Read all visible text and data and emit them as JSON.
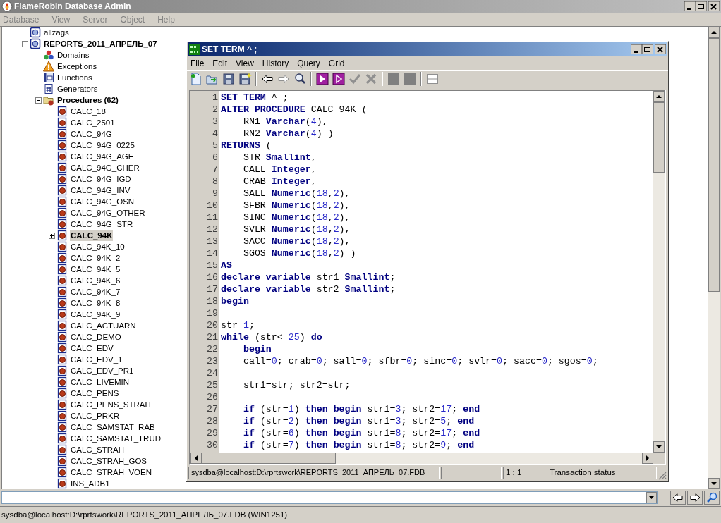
{
  "app": {
    "title": "FlameRobin Database Admin",
    "menu": [
      "Database",
      "View",
      "Server",
      "Object",
      "Help"
    ]
  },
  "tree": [
    {
      "kind": "database",
      "label": "allzags",
      "selected": false
    },
    {
      "kind": "database",
      "label": "REPORTS_2011_АПРЕЛЬ_07",
      "selected": false,
      "expanded": true,
      "children": [
        {
          "kind": "domains",
          "label": "Domains",
          "selected": false
        },
        {
          "kind": "exceptions",
          "label": "Exceptions",
          "selected": false
        },
        {
          "kind": "functions",
          "label": "Functions",
          "selected": false
        },
        {
          "kind": "generators",
          "label": "Generators",
          "selected": false
        },
        {
          "kind": "procedures",
          "label": "Procedures (62)",
          "selected": false,
          "expanded": true,
          "children": [
            {
              "kind": "procedure",
              "label": "CALC_18",
              "selected": false
            },
            {
              "kind": "procedure",
              "label": "CALC_2501",
              "selected": false
            },
            {
              "kind": "procedure",
              "label": "CALC_94G",
              "selected": false
            },
            {
              "kind": "procedure",
              "label": "CALC_94G_0225",
              "selected": false
            },
            {
              "kind": "procedure",
              "label": "CALC_94G_AGE",
              "selected": false
            },
            {
              "kind": "procedure",
              "label": "CALC_94G_CHER",
              "selected": false
            },
            {
              "kind": "procedure",
              "label": "CALC_94G_IGD",
              "selected": false
            },
            {
              "kind": "procedure",
              "label": "CALC_94G_INV",
              "selected": false
            },
            {
              "kind": "procedure",
              "label": "CALC_94G_OSN",
              "selected": false
            },
            {
              "kind": "procedure",
              "label": "CALC_94G_OTHER",
              "selected": false
            },
            {
              "kind": "procedure",
              "label": "CALC_94G_STR",
              "selected": false
            },
            {
              "kind": "procedure",
              "label": "CALC_94K",
              "selected": true,
              "expanded": false
            },
            {
              "kind": "procedure",
              "label": "CALC_94K_10",
              "selected": false
            },
            {
              "kind": "procedure",
              "label": "CALC_94K_2",
              "selected": false
            },
            {
              "kind": "procedure",
              "label": "CALC_94K_5",
              "selected": false
            },
            {
              "kind": "procedure",
              "label": "CALC_94K_6",
              "selected": false
            },
            {
              "kind": "procedure",
              "label": "CALC_94K_7",
              "selected": false
            },
            {
              "kind": "procedure",
              "label": "CALC_94K_8",
              "selected": false
            },
            {
              "kind": "procedure",
              "label": "CALC_94K_9",
              "selected": false
            },
            {
              "kind": "procedure",
              "label": "CALC_ACTUARN",
              "selected": false
            },
            {
              "kind": "procedure",
              "label": "CALC_DEMO",
              "selected": false
            },
            {
              "kind": "procedure",
              "label": "CALC_EDV",
              "selected": false
            },
            {
              "kind": "procedure",
              "label": "CALC_EDV_1",
              "selected": false
            },
            {
              "kind": "procedure",
              "label": "CALC_EDV_PR1",
              "selected": false
            },
            {
              "kind": "procedure",
              "label": "CALC_LIVEMIN",
              "selected": false
            },
            {
              "kind": "procedure",
              "label": "CALC_PENS",
              "selected": false
            },
            {
              "kind": "procedure",
              "label": "CALC_PENS_STRAH",
              "selected": false
            },
            {
              "kind": "procedure",
              "label": "CALC_PRKR",
              "selected": false
            },
            {
              "kind": "procedure",
              "label": "CALC_SAMSTAT_RAB",
              "selected": false
            },
            {
              "kind": "procedure",
              "label": "CALC_SAMSTAT_TRUD",
              "selected": false
            },
            {
              "kind": "procedure",
              "label": "CALC_STRAH",
              "selected": false
            },
            {
              "kind": "procedure",
              "label": "CALC_STRAH_GOS",
              "selected": false
            },
            {
              "kind": "procedure",
              "label": "CALC_STRAH_VOEN",
              "selected": false
            },
            {
              "kind": "procedure",
              "label": "INS_ADB1",
              "selected": false
            }
          ]
        }
      ]
    }
  ],
  "editor_window": {
    "title": "SET TERM ^ ;",
    "menu": [
      "File",
      "Edit",
      "View",
      "History",
      "Query",
      "Grid"
    ],
    "toolbar": [
      {
        "kind": "new",
        "disabled": false
      },
      {
        "kind": "open",
        "disabled": false
      },
      {
        "kind": "save",
        "disabled": false
      },
      {
        "kind": "save_as",
        "disabled": false
      },
      {
        "kind": "separator"
      },
      {
        "kind": "back",
        "disabled": false
      },
      {
        "kind": "forward",
        "disabled": true
      },
      {
        "kind": "find",
        "disabled": false
      },
      {
        "kind": "separator"
      },
      {
        "kind": "execute",
        "disabled": false
      },
      {
        "kind": "execute_step",
        "disabled": false
      },
      {
        "kind": "commit",
        "disabled": true
      },
      {
        "kind": "rollback",
        "disabled": true
      },
      {
        "kind": "separator"
      },
      {
        "kind": "grid_cell",
        "disabled": true
      },
      {
        "kind": "grid_cell",
        "disabled": true
      },
      {
        "kind": "separator"
      },
      {
        "kind": "split",
        "disabled": true
      }
    ],
    "lines": [
      {
        "number": "1",
        "tokens": [
          {
            "kind": "kw",
            "text": "SET TERM"
          },
          {
            "kind": "plain",
            "text": " ^ ;"
          }
        ]
      },
      {
        "number": "2",
        "tokens": [
          {
            "kind": "kw",
            "text": "ALTER PROCEDURE"
          },
          {
            "kind": "plain",
            "text": " CALC_94K ("
          }
        ]
      },
      {
        "number": "3",
        "tokens": [
          {
            "kind": "plain",
            "text": "    RN1 "
          },
          {
            "kind": "kw",
            "text": "Varchar"
          },
          {
            "kind": "plain",
            "text": "("
          },
          {
            "kind": "num",
            "text": "4"
          },
          {
            "kind": "plain",
            "text": "),"
          }
        ]
      },
      {
        "number": "4",
        "tokens": [
          {
            "kind": "plain",
            "text": "    RN2 "
          },
          {
            "kind": "kw",
            "text": "Varchar"
          },
          {
            "kind": "plain",
            "text": "("
          },
          {
            "kind": "num",
            "text": "4"
          },
          {
            "kind": "plain",
            "text": ") )"
          }
        ]
      },
      {
        "number": "5",
        "tokens": [
          {
            "kind": "kw",
            "text": "RETURNS"
          },
          {
            "kind": "plain",
            "text": " ("
          }
        ]
      },
      {
        "number": "6",
        "tokens": [
          {
            "kind": "plain",
            "text": "    STR "
          },
          {
            "kind": "kw",
            "text": "Smallint"
          },
          {
            "kind": "plain",
            "text": ","
          }
        ]
      },
      {
        "number": "7",
        "tokens": [
          {
            "kind": "plain",
            "text": "    CALL "
          },
          {
            "kind": "kw",
            "text": "Integer"
          },
          {
            "kind": "plain",
            "text": ","
          }
        ]
      },
      {
        "number": "8",
        "tokens": [
          {
            "kind": "plain",
            "text": "    CRAB "
          },
          {
            "kind": "kw",
            "text": "Integer"
          },
          {
            "kind": "plain",
            "text": ","
          }
        ]
      },
      {
        "number": "9",
        "tokens": [
          {
            "kind": "plain",
            "text": "    SALL "
          },
          {
            "kind": "kw",
            "text": "Numeric"
          },
          {
            "kind": "plain",
            "text": "("
          },
          {
            "kind": "num",
            "text": "18"
          },
          {
            "kind": "plain",
            "text": ","
          },
          {
            "kind": "num",
            "text": "2"
          },
          {
            "kind": "plain",
            "text": "),"
          }
        ]
      },
      {
        "number": "10",
        "tokens": [
          {
            "kind": "plain",
            "text": "    SFBR "
          },
          {
            "kind": "kw",
            "text": "Numeric"
          },
          {
            "kind": "plain",
            "text": "("
          },
          {
            "kind": "num",
            "text": "18"
          },
          {
            "kind": "plain",
            "text": ","
          },
          {
            "kind": "num",
            "text": "2"
          },
          {
            "kind": "plain",
            "text": "),"
          }
        ]
      },
      {
        "number": "11",
        "tokens": [
          {
            "kind": "plain",
            "text": "    SINC "
          },
          {
            "kind": "kw",
            "text": "Numeric"
          },
          {
            "kind": "plain",
            "text": "("
          },
          {
            "kind": "num",
            "text": "18"
          },
          {
            "kind": "plain",
            "text": ","
          },
          {
            "kind": "num",
            "text": "2"
          },
          {
            "kind": "plain",
            "text": "),"
          }
        ]
      },
      {
        "number": "12",
        "tokens": [
          {
            "kind": "plain",
            "text": "    SVLR "
          },
          {
            "kind": "kw",
            "text": "Numeric"
          },
          {
            "kind": "plain",
            "text": "("
          },
          {
            "kind": "num",
            "text": "18"
          },
          {
            "kind": "plain",
            "text": ","
          },
          {
            "kind": "num",
            "text": "2"
          },
          {
            "kind": "plain",
            "text": "),"
          }
        ]
      },
      {
        "number": "13",
        "tokens": [
          {
            "kind": "plain",
            "text": "    SACC "
          },
          {
            "kind": "kw",
            "text": "Numeric"
          },
          {
            "kind": "plain",
            "text": "("
          },
          {
            "kind": "num",
            "text": "18"
          },
          {
            "kind": "plain",
            "text": ","
          },
          {
            "kind": "num",
            "text": "2"
          },
          {
            "kind": "plain",
            "text": "),"
          }
        ]
      },
      {
        "number": "14",
        "tokens": [
          {
            "kind": "plain",
            "text": "    SGOS "
          },
          {
            "kind": "kw",
            "text": "Numeric"
          },
          {
            "kind": "plain",
            "text": "("
          },
          {
            "kind": "num",
            "text": "18"
          },
          {
            "kind": "plain",
            "text": ","
          },
          {
            "kind": "num",
            "text": "2"
          },
          {
            "kind": "plain",
            "text": ") )"
          }
        ]
      },
      {
        "number": "15",
        "tokens": [
          {
            "kind": "kw",
            "text": "AS"
          }
        ]
      },
      {
        "number": "16",
        "tokens": [
          {
            "kind": "kw",
            "text": "declare variable"
          },
          {
            "kind": "plain",
            "text": " str1 "
          },
          {
            "kind": "kw",
            "text": "Smallint"
          },
          {
            "kind": "plain",
            "text": ";"
          }
        ]
      },
      {
        "number": "17",
        "tokens": [
          {
            "kind": "kw",
            "text": "declare variable"
          },
          {
            "kind": "plain",
            "text": " str2 "
          },
          {
            "kind": "kw",
            "text": "Smallint"
          },
          {
            "kind": "plain",
            "text": ";"
          }
        ]
      },
      {
        "number": "18",
        "tokens": [
          {
            "kind": "kw",
            "text": "begin"
          }
        ]
      },
      {
        "number": "19"
      },
      {
        "number": "20",
        "tokens": [
          {
            "kind": "plain",
            "text": "str="
          },
          {
            "kind": "num",
            "text": "1"
          },
          {
            "kind": "plain",
            "text": ";"
          }
        ]
      },
      {
        "number": "21",
        "tokens": [
          {
            "kind": "kw",
            "text": "while"
          },
          {
            "kind": "plain",
            "text": " (str<="
          },
          {
            "kind": "num",
            "text": "25"
          },
          {
            "kind": "plain",
            "text": ") "
          },
          {
            "kind": "kw",
            "text": "do"
          }
        ]
      },
      {
        "number": "22",
        "tokens": [
          {
            "kind": "kw",
            "text": "    begin"
          }
        ]
      },
      {
        "number": "23",
        "tokens": [
          {
            "kind": "plain",
            "text": "    call="
          },
          {
            "kind": "num",
            "text": "0"
          },
          {
            "kind": "plain",
            "text": "; crab="
          },
          {
            "kind": "num",
            "text": "0"
          },
          {
            "kind": "plain",
            "text": "; sall="
          },
          {
            "kind": "num",
            "text": "0"
          },
          {
            "kind": "plain",
            "text": "; sfbr="
          },
          {
            "kind": "num",
            "text": "0"
          },
          {
            "kind": "plain",
            "text": "; sinc="
          },
          {
            "kind": "num",
            "text": "0"
          },
          {
            "kind": "plain",
            "text": "; svlr="
          },
          {
            "kind": "num",
            "text": "0"
          },
          {
            "kind": "plain",
            "text": "; sacc="
          },
          {
            "kind": "num",
            "text": "0"
          },
          {
            "kind": "plain",
            "text": "; sgos="
          },
          {
            "kind": "num",
            "text": "0"
          },
          {
            "kind": "plain",
            "text": ";"
          }
        ]
      },
      {
        "number": "24"
      },
      {
        "number": "25",
        "tokens": [
          {
            "kind": "plain",
            "text": "    str1=str; str2=str;"
          }
        ]
      },
      {
        "number": "26"
      },
      {
        "number": "27",
        "tokens": [
          {
            "kind": "kw",
            "text": "    if"
          },
          {
            "kind": "plain",
            "text": " (str="
          },
          {
            "kind": "num",
            "text": "1"
          },
          {
            "kind": "plain",
            "text": ") "
          },
          {
            "kind": "kw",
            "text": "then begin"
          },
          {
            "kind": "plain",
            "text": " str1="
          },
          {
            "kind": "num",
            "text": "3"
          },
          {
            "kind": "plain",
            "text": "; str2="
          },
          {
            "kind": "num",
            "text": "17"
          },
          {
            "kind": "plain",
            "text": "; "
          },
          {
            "kind": "kw",
            "text": "end"
          }
        ]
      },
      {
        "number": "28",
        "tokens": [
          {
            "kind": "kw",
            "text": "    if"
          },
          {
            "kind": "plain",
            "text": " (str="
          },
          {
            "kind": "num",
            "text": "2"
          },
          {
            "kind": "plain",
            "text": ") "
          },
          {
            "kind": "kw",
            "text": "then begin"
          },
          {
            "kind": "plain",
            "text": " str1="
          },
          {
            "kind": "num",
            "text": "3"
          },
          {
            "kind": "plain",
            "text": "; str2="
          },
          {
            "kind": "num",
            "text": "5"
          },
          {
            "kind": "plain",
            "text": "; "
          },
          {
            "kind": "kw",
            "text": "end"
          }
        ]
      },
      {
        "number": "29",
        "tokens": [
          {
            "kind": "kw",
            "text": "    if"
          },
          {
            "kind": "plain",
            "text": " (str="
          },
          {
            "kind": "num",
            "text": "6"
          },
          {
            "kind": "plain",
            "text": ") "
          },
          {
            "kind": "kw",
            "text": "then begin"
          },
          {
            "kind": "plain",
            "text": " str1="
          },
          {
            "kind": "num",
            "text": "8"
          },
          {
            "kind": "plain",
            "text": "; str2="
          },
          {
            "kind": "num",
            "text": "17"
          },
          {
            "kind": "plain",
            "text": "; "
          },
          {
            "kind": "kw",
            "text": "end"
          }
        ]
      },
      {
        "number": "30",
        "tokens": [
          {
            "kind": "kw",
            "text": "    if"
          },
          {
            "kind": "plain",
            "text": " (str="
          },
          {
            "kind": "num",
            "text": "7"
          },
          {
            "kind": "plain",
            "text": ") "
          },
          {
            "kind": "kw",
            "text": "then begin"
          },
          {
            "kind": "plain",
            "text": " str1="
          },
          {
            "kind": "num",
            "text": "8"
          },
          {
            "kind": "plain",
            "text": "; str2="
          },
          {
            "kind": "num",
            "text": "9"
          },
          {
            "kind": "plain",
            "text": "; "
          },
          {
            "kind": "kw",
            "text": "end"
          }
        ]
      }
    ],
    "status": {
      "connection": "sysdba@localhost:D:\\rprtswork\\REPORTS_2011_АПРЕЛЬ_07.FDB",
      "position": "1 : 1",
      "transaction": "Transaction status"
    }
  },
  "status_bar": "sysdba@localhost:D:\\rprtswork\\REPORTS_2011_АПРЕЛЬ_07.FDB (WIN1251)"
}
